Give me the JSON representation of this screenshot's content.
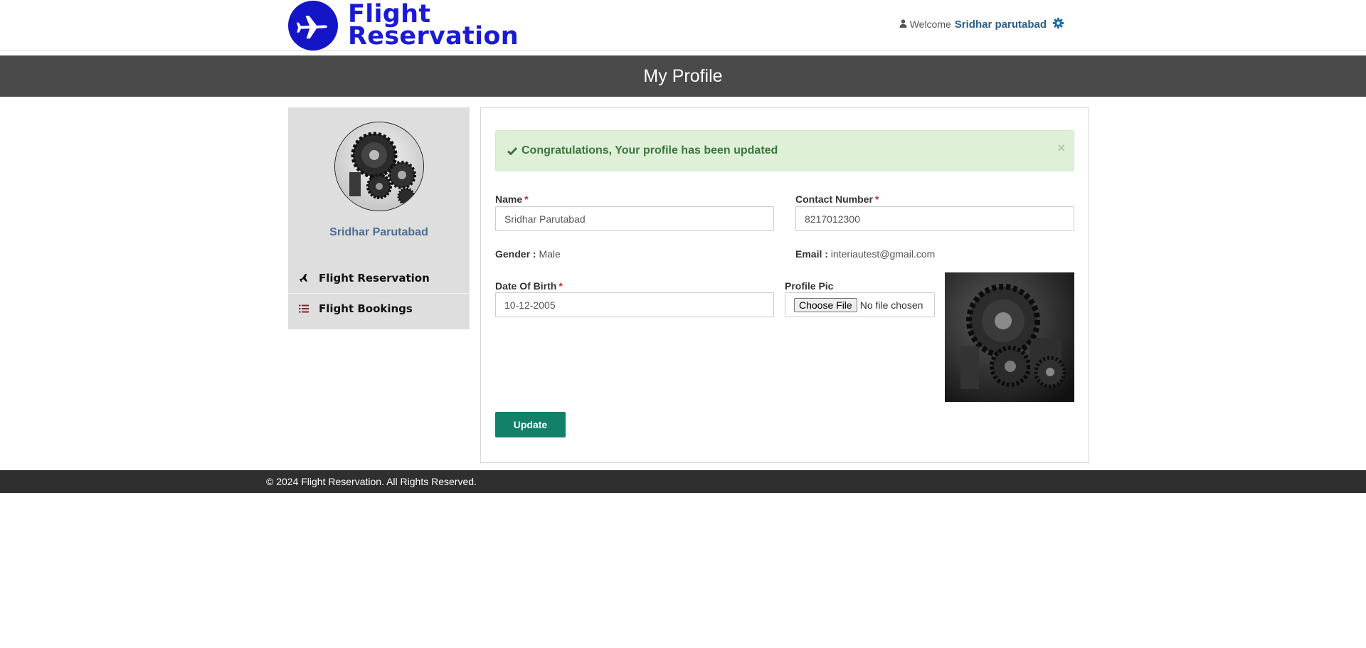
{
  "header": {
    "logo_line1": "Flight",
    "logo_line2": "Reservation",
    "welcome_label": "Welcome",
    "username": "Sridhar parutabad",
    "icons": {
      "user": "user-icon",
      "settings": "gear-icon",
      "logo": "airplane-icon"
    }
  },
  "page": {
    "title": "My Profile"
  },
  "sidebar": {
    "name": "Sridhar Parutabad",
    "items": [
      {
        "label": "Flight Reservation",
        "icon": "airplane-icon"
      },
      {
        "label": "Flight Bookings",
        "icon": "list-icon"
      }
    ]
  },
  "alert": {
    "message": "Congratulations, Your profile has been updated",
    "close": "×",
    "icon": "check-icon"
  },
  "form": {
    "name": {
      "label": "Name",
      "required": "*",
      "value": "Sridhar Parutabad"
    },
    "contact": {
      "label": "Contact Number",
      "required": "*",
      "value": "8217012300"
    },
    "gender": {
      "label": "Gender :",
      "value": "Male"
    },
    "email": {
      "label": "Email :",
      "value": "interiautest@gmail.com"
    },
    "dob": {
      "label": "Date Of Birth",
      "required": "*",
      "value": "10-12-2005"
    },
    "profile_pic": {
      "label": "Profile Pic",
      "button": "Choose File",
      "status": "No file chosen"
    },
    "update_label": "Update"
  },
  "footer": {
    "text": "© 2024 Flight Reservation. All Rights Reserved."
  },
  "colors": {
    "brand_blue": "#1515c8",
    "title_band": "#4a4a4a",
    "success_bg": "#dff0d8",
    "update_button": "#138069",
    "footer": "#2f2f2f"
  }
}
